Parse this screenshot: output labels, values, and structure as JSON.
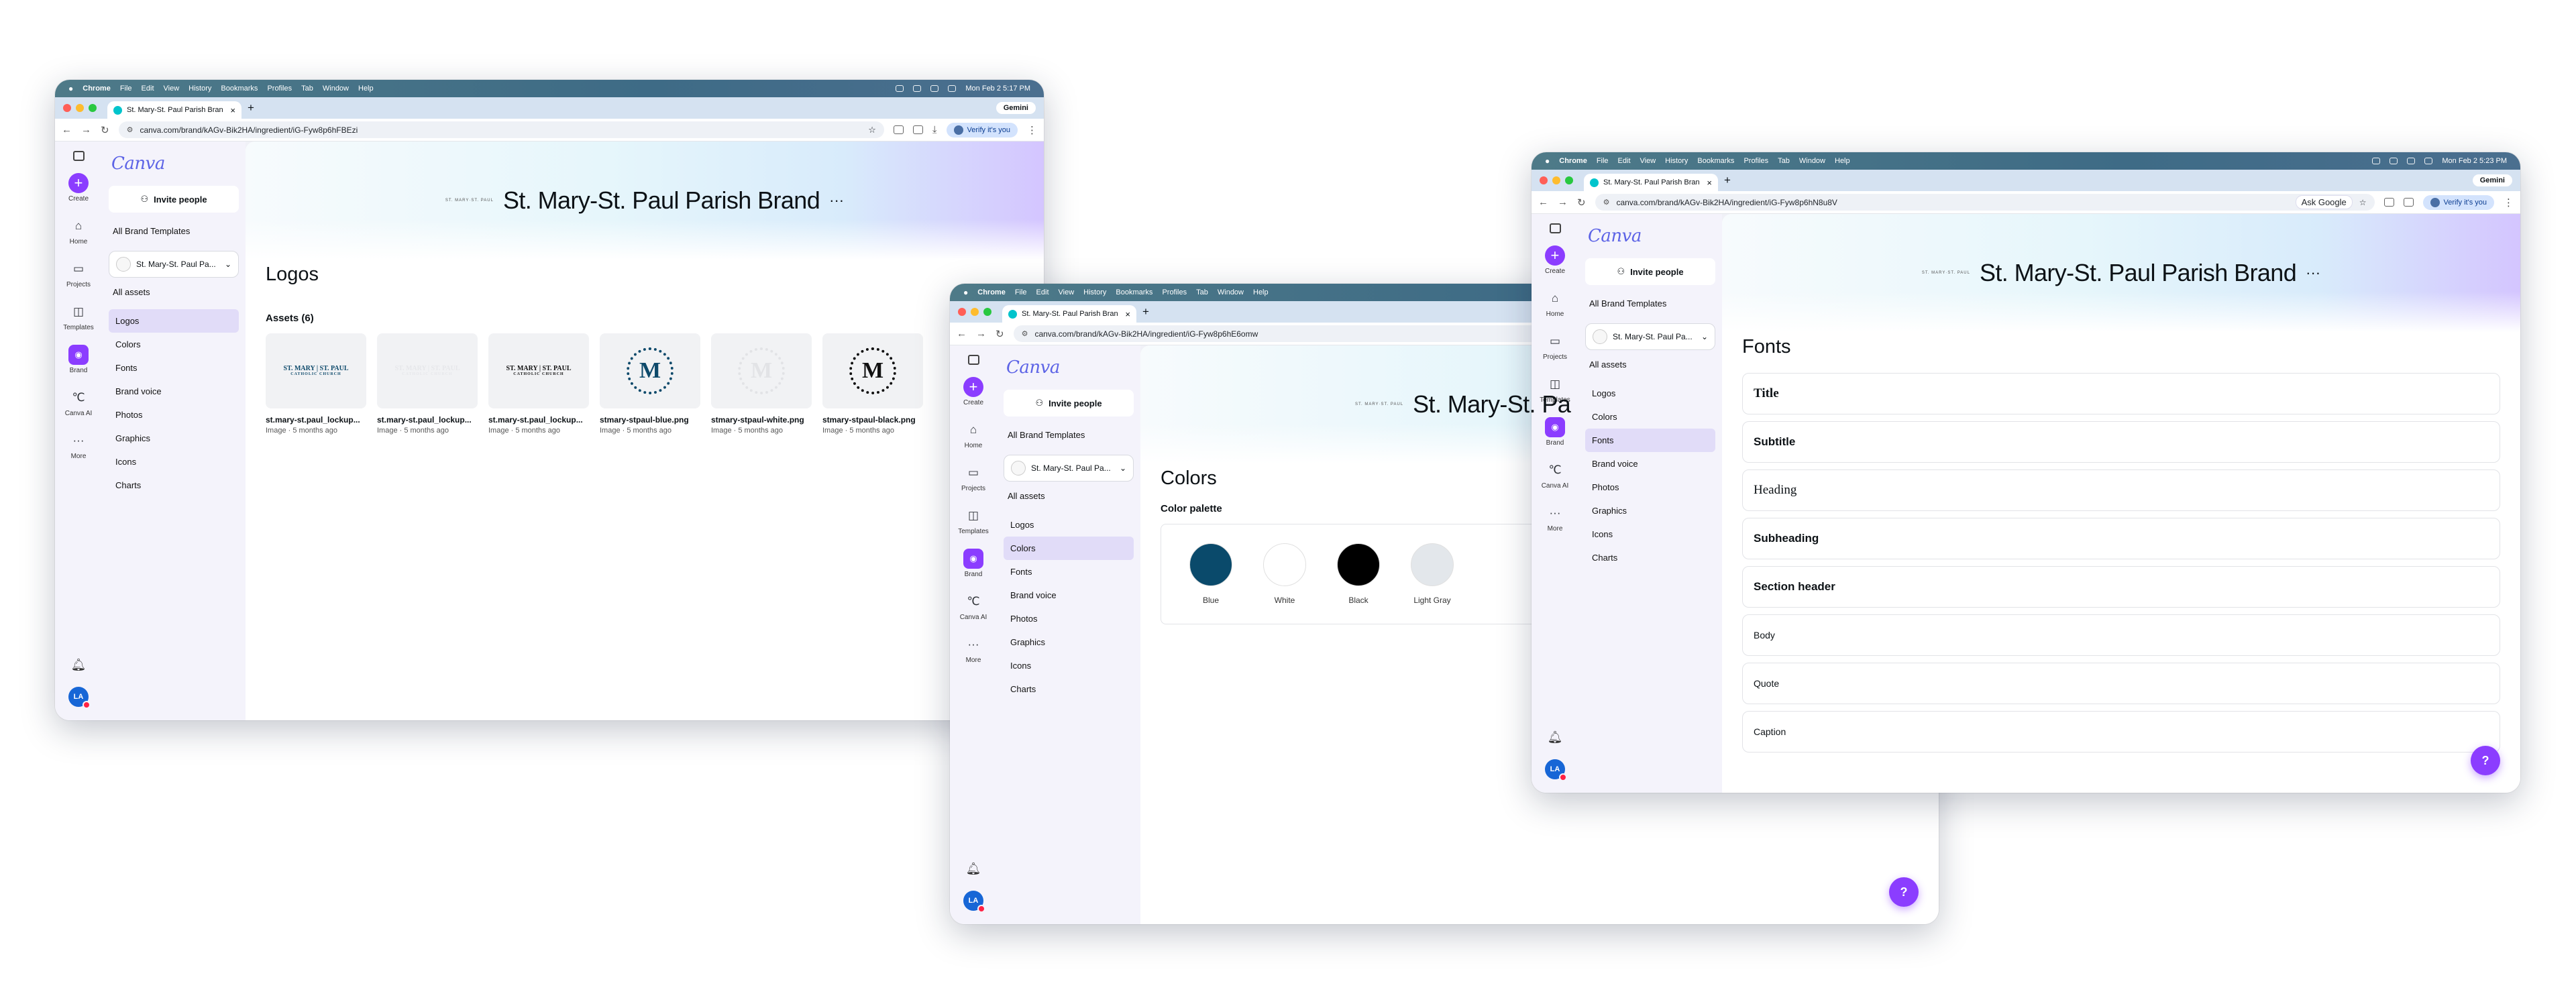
{
  "browser": {
    "app_name": "Chrome",
    "menu": [
      "File",
      "Edit",
      "View",
      "History",
      "Bookmarks",
      "Profiles",
      "Tab",
      "Window",
      "Help"
    ],
    "new_tab": "+",
    "gemini": "Gemini",
    "ask_google": "Ask Google",
    "verify": "Verify it's you",
    "tab_close": "×"
  },
  "traffic_colors": [
    "#ff5f57",
    "#febc2e",
    "#28c840"
  ],
  "windows": [
    {
      "clock": "Mon Feb 2  5:17 PM",
      "tab_title": "St. Mary-St. Paul Parish Bran",
      "url": "canva.com/brand/kAGv-Bik2HA/ingredient/iG-Fyw8p6hFBEzi"
    },
    {
      "tab_title": "St. Mary-St. Paul Parish Bran",
      "url": "canva.com/brand/kAGv-Bik2HA/ingredient/iG-Fyw8p6hE6omw"
    },
    {
      "clock": "Mon Feb 2  5:23 PM",
      "tab_title": "St. Mary-St. Paul Parish Bran",
      "url": "canva.com/brand/kAGv-Bik2HA/ingredient/iG-Fyw8p6hN8u8V"
    }
  ],
  "canva": {
    "logo": "Canva",
    "invite": "Invite people",
    "all_templates": "All Brand Templates",
    "brand_kit": "St. Mary-St. Paul Pa...",
    "all_assets": "All assets",
    "nav": [
      "Logos",
      "Colors",
      "Fonts",
      "Brand voice",
      "Photos",
      "Graphics",
      "Icons",
      "Charts"
    ],
    "rail": [
      "Create",
      "Home",
      "Projects",
      "Templates",
      "Brand",
      "Canva AI",
      "More"
    ],
    "user_initials": "LA",
    "help": "?",
    "brand_title": "St. Mary-St. Paul Parish Brand",
    "brand_more": "···",
    "brand_mini": "ST. MARY·ST. PAUL",
    "brand_title_truncated": "St. Mary-St. Pa"
  },
  "logos_page": {
    "heading": "Logos",
    "assets_label": "Assets (6)",
    "assets": [
      {
        "name": "st.mary-st.paul_lockup...",
        "meta": "Image · 5 months ago",
        "kind": "wordmark",
        "color": "#0e4a6b",
        "bg": "#f1f2f4",
        "mark": "ST. MARY | ST. PAUL",
        "mark_sub": "CATHOLIC CHURCH"
      },
      {
        "name": "st.mary-st.paul_lockup...",
        "meta": "Image · 5 months ago",
        "kind": "wordmark",
        "color": "#e6e7ea",
        "bg": "#f1f2f4",
        "mark": "ST. MARY | ST. PAUL",
        "mark_sub": "CATHOLIC CHURCH"
      },
      {
        "name": "st.mary-st.paul_lockup...",
        "meta": "Image · 5 months ago",
        "kind": "wordmark",
        "color": "#111111",
        "bg": "#f1f2f4",
        "mark": "ST. MARY | ST. PAUL",
        "mark_sub": "CATHOLIC CHURCH"
      },
      {
        "name": "stmary-stpaul-blue.png",
        "meta": "Image · 5 months ago",
        "kind": "seal",
        "color": "#0e4a6b",
        "bg": "#f1f2f4",
        "mark": "M"
      },
      {
        "name": "stmary-stpaul-white.png",
        "meta": "Image · 5 months ago",
        "kind": "seal",
        "color": "#e2e3e6",
        "bg": "#f1f2f4",
        "mark": "M"
      },
      {
        "name": "stmary-stpaul-black.png",
        "meta": "Image · 5 months ago",
        "kind": "seal",
        "color": "#111111",
        "bg": "#f1f2f4",
        "mark": "M"
      }
    ]
  },
  "colors_page": {
    "heading": "Colors",
    "palette_label": "Color palette",
    "swatches": [
      {
        "name": "Blue",
        "hex": "#0a4a6b"
      },
      {
        "name": "White",
        "hex": "#ffffff"
      },
      {
        "name": "Black",
        "hex": "#000000"
      },
      {
        "name": "Light Gray",
        "hex": "#e3e7eb"
      }
    ]
  },
  "fonts_page": {
    "heading": "Fonts",
    "styles": [
      {
        "label": "Title",
        "family": "serif-bold"
      },
      {
        "label": "Subtitle",
        "family": "sans-bold"
      },
      {
        "label": "Heading",
        "family": "serif"
      },
      {
        "label": "Subheading",
        "family": "sans-bold"
      },
      {
        "label": "Section header",
        "family": "sans-bold"
      },
      {
        "label": "Body",
        "family": "sans"
      },
      {
        "label": "Quote",
        "family": "sans"
      },
      {
        "label": "Caption",
        "family": "sans"
      }
    ]
  }
}
